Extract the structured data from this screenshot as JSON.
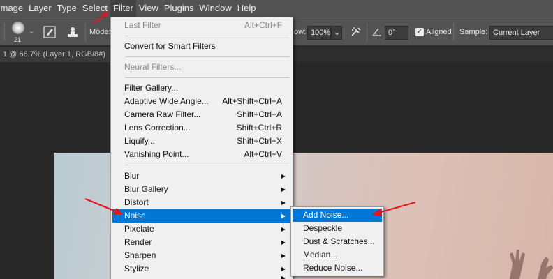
{
  "menubar": {
    "items": [
      "Image",
      "Layer",
      "Type",
      "Select",
      "Filter",
      "View",
      "Plugins",
      "Window",
      "Help"
    ]
  },
  "options_bar": {
    "brush_size": "21",
    "mode_label": "Mode:",
    "flow_label": "ow:",
    "flow_value": "100%",
    "angle_value": "0°",
    "aligned_label": "Aligned",
    "sample_label": "Sample:",
    "sample_value": "Current Layer"
  },
  "document": {
    "tab_title": "1 @ 66.7% (Layer 1, RGB/8#)"
  },
  "filter_menu": {
    "last_filter": {
      "label": "Last Filter",
      "shortcut": "Alt+Ctrl+F"
    },
    "convert_smart": "Convert for Smart Filters",
    "neural_filters": "Neural Filters...",
    "group2": [
      {
        "label": "Filter Gallery...",
        "shortcut": ""
      },
      {
        "label": "Adaptive Wide Angle...",
        "shortcut": "Alt+Shift+Ctrl+A"
      },
      {
        "label": "Camera Raw Filter...",
        "shortcut": "Shift+Ctrl+A"
      },
      {
        "label": "Lens Correction...",
        "shortcut": "Shift+Ctrl+R"
      },
      {
        "label": "Liquify...",
        "shortcut": "Shift+Ctrl+X"
      },
      {
        "label": "Vanishing Point...",
        "shortcut": "Alt+Ctrl+V"
      }
    ],
    "group3": [
      "Blur",
      "Blur Gallery",
      "Distort",
      "Noise",
      "Pixelate",
      "Render",
      "Sharpen",
      "Stylize"
    ],
    "highlighted": "Noise"
  },
  "noise_submenu": {
    "items": [
      "Add Noise...",
      "Despeckle",
      "Dust & Scratches...",
      "Median...",
      "Reduce Noise..."
    ],
    "highlighted": "Add Noise..."
  },
  "colors": {
    "highlight": "#0078d7",
    "annotation_arrow": "#e8141c"
  }
}
